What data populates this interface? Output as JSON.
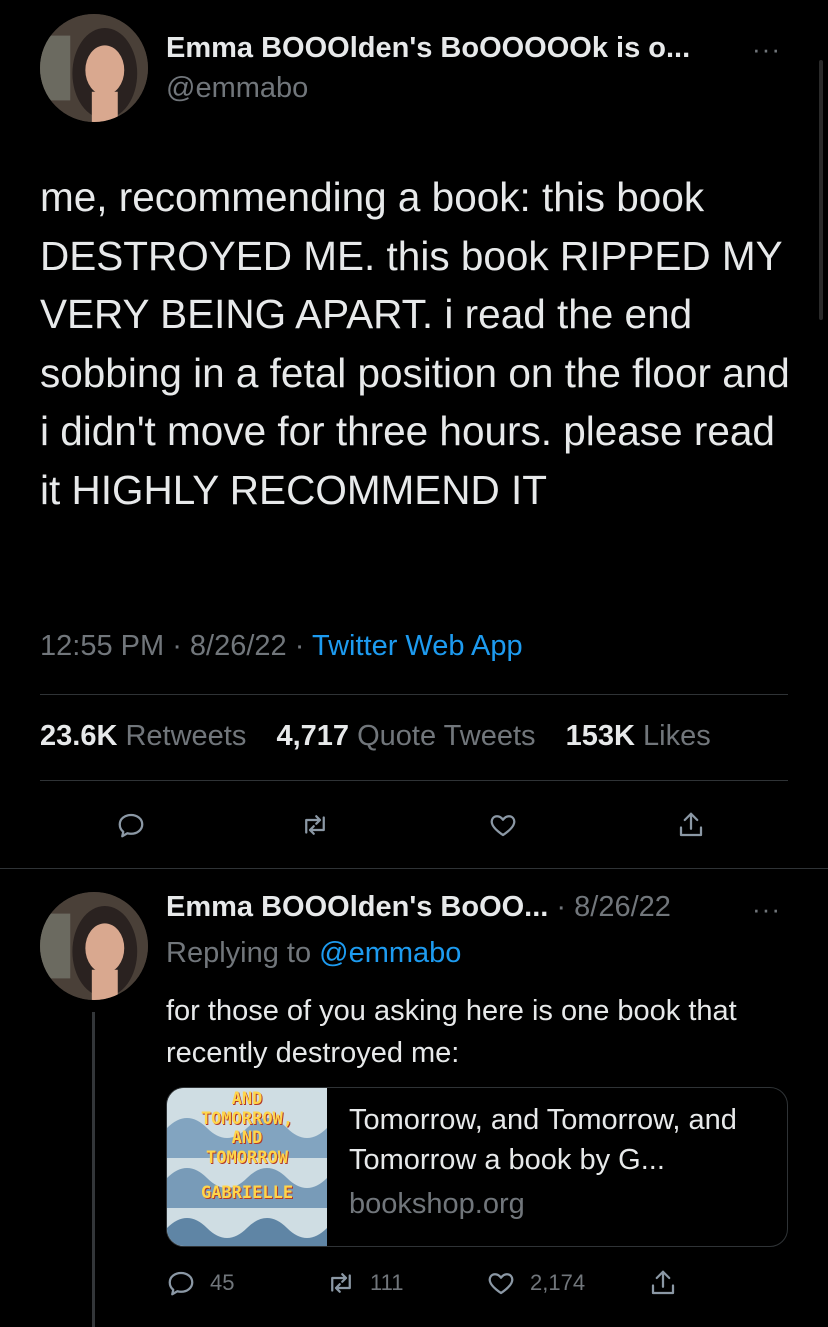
{
  "main_tweet": {
    "author_name": "Emma BOOOlden's BoOOOOOk is o...",
    "handle": "@emmabo",
    "more_glyph": "···",
    "text": "me, recommending a book: this book DESTROYED ME. this book RIPPED MY VERY BEING APART. i read the end sobbing in a fetal position on the floor and i didn't move for three hours. please read it HIGHLY RECOMMEND IT",
    "time": "12:55 PM",
    "date": "8/26/22",
    "source": "Twitter Web App",
    "stats": {
      "retweets_count": "23.6K",
      "retweets_label": "Retweets",
      "quotes_count": "4,717",
      "quotes_label": "Quote Tweets",
      "likes_count": "153K",
      "likes_label": "Likes"
    }
  },
  "reply_tweet": {
    "author_name": "Emma BOOOlden's BoOO...",
    "date": "8/26/22",
    "more_glyph": "···",
    "replying_prefix": "Replying to",
    "replying_handle": "@emmabo",
    "text": "for those of you asking here is one book that recently destroyed me:",
    "card": {
      "cover_lines": [
        "AND",
        "TOMORROW,",
        "AND",
        "TOMORROW",
        "GABRIELLE"
      ],
      "title": "Tomorrow, and Tomorrow, and Tomorrow a book by G...",
      "domain": "bookshop.org"
    },
    "actions": {
      "replies": "45",
      "retweets": "111",
      "likes": "2,174"
    }
  },
  "colors": {
    "background": "#000000",
    "text": "#e7e9ea",
    "muted": "#71767b",
    "link": "#1d9bf0"
  },
  "icons": [
    "reply-icon",
    "retweet-icon",
    "like-icon",
    "share-icon",
    "more-icon"
  ]
}
